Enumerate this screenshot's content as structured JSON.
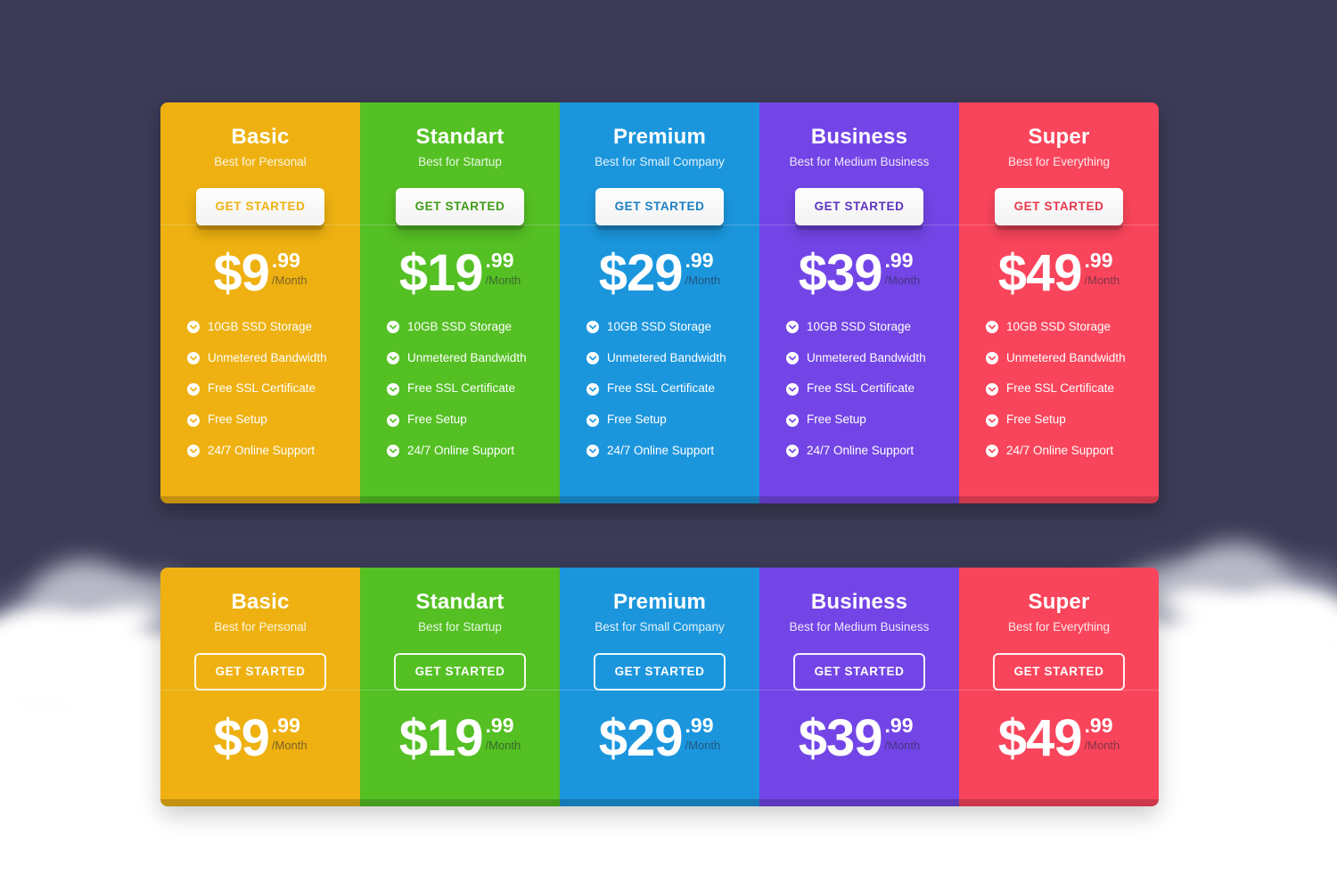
{
  "theme": {
    "page_background": "#3b3b57",
    "lower_background": "#ffffff",
    "colors": {
      "basic": "#eeb111",
      "standart": "#54c023",
      "premium": "#1b96dd",
      "business": "#7345e6",
      "super": "#f9455b"
    }
  },
  "features_label": {
    "storage": "10GB SSD Storage",
    "bandwidth": "Unmetered Bandwidth",
    "ssl": "Free SSL Certificate",
    "setup": "Free Setup",
    "support": "24/7 Online Support"
  },
  "tables": [
    {
      "id": "featured",
      "button_style": "solid",
      "has_features": true,
      "columns": [
        {
          "key": "basic",
          "name": "Basic",
          "tagline": "Best for Personal",
          "cta": "GET STARTED",
          "cta_text_color": "#eeb111",
          "bg": "#eeb111",
          "currency": "$",
          "amount": "9",
          "cents": ".99",
          "period": "/Month",
          "price_display": "$9.99",
          "features": [
            "10GB SSD Storage",
            "Unmetered Bandwidth",
            "Free SSL Certificate",
            "Free Setup",
            "24/7 Online Support"
          ]
        },
        {
          "key": "standart",
          "name": "Standart",
          "tagline": "Best for Startup",
          "cta": "GET STARTED",
          "cta_text_color": "#3f9a18",
          "bg": "#54c023",
          "currency": "$",
          "amount": "19",
          "cents": ".99",
          "period": "/Month",
          "price_display": "$19.99",
          "features": [
            "10GB SSD Storage",
            "Unmetered Bandwidth",
            "Free SSL Certificate",
            "Free Setup",
            "24/7 Online Support"
          ]
        },
        {
          "key": "premium",
          "name": "Premium",
          "tagline": "Best for Small Company",
          "cta": "GET STARTED",
          "cta_text_color": "#1b7fc4",
          "bg": "#1b96dd",
          "currency": "$",
          "amount": "29",
          "cents": ".99",
          "period": "/Month",
          "price_display": "$29.99",
          "features": [
            "10GB SSD Storage",
            "Unmetered Bandwidth",
            "Free SSL Certificate",
            "Free Setup",
            "24/7 Online Support"
          ]
        },
        {
          "key": "business",
          "name": "Business",
          "tagline": "Best for Medium Business",
          "cta": "GET STARTED",
          "cta_text_color": "#5b33c0",
          "bg": "#7345e6",
          "currency": "$",
          "amount": "39",
          "cents": ".99",
          "period": "/Month",
          "price_display": "$39.99",
          "features": [
            "10GB SSD Storage",
            "Unmetered Bandwidth",
            "Free SSL Certificate",
            "Free Setup",
            "24/7 Online Support"
          ]
        },
        {
          "key": "super",
          "name": "Super",
          "tagline": "Best for Everything",
          "cta": "GET STARTED",
          "cta_text_color": "#e8374d",
          "bg": "#f9455b",
          "currency": "$",
          "amount": "49",
          "cents": ".99",
          "period": "/Month",
          "price_display": "$49.99",
          "features": [
            "10GB SSD Storage",
            "Unmetered Bandwidth",
            "Free SSL Certificate",
            "Free Setup",
            "24/7 Online Support"
          ]
        }
      ]
    },
    {
      "id": "compact",
      "button_style": "ghost",
      "has_features": false,
      "columns": [
        {
          "key": "basic",
          "name": "Basic",
          "tagline": "Best for Personal",
          "cta": "GET STARTED",
          "bg": "#eeb111",
          "currency": "$",
          "amount": "9",
          "cents": ".99",
          "period": "/Month",
          "price_display": "$9.99"
        },
        {
          "key": "standart",
          "name": "Standart",
          "tagline": "Best for Startup",
          "cta": "GET STARTED",
          "bg": "#54c023",
          "currency": "$",
          "amount": "19",
          "cents": ".99",
          "period": "/Month",
          "price_display": "$19.99"
        },
        {
          "key": "premium",
          "name": "Premium",
          "tagline": "Best for Small Company",
          "cta": "GET STARTED",
          "bg": "#1b96dd",
          "currency": "$",
          "amount": "29",
          "cents": ".99",
          "period": "/Month",
          "price_display": "$29.99"
        },
        {
          "key": "business",
          "name": "Business",
          "tagline": "Best for Medium Business",
          "cta": "GET STARTED",
          "bg": "#7345e6",
          "currency": "$",
          "amount": "39",
          "cents": ".99",
          "period": "/Month",
          "price_display": "$39.99"
        },
        {
          "key": "super",
          "name": "Super",
          "tagline": "Best for Everything",
          "cta": "GET STARTED",
          "bg": "#f9455b",
          "currency": "$",
          "amount": "49",
          "cents": ".99",
          "period": "/Month",
          "price_display": "$49.99"
        }
      ]
    }
  ]
}
